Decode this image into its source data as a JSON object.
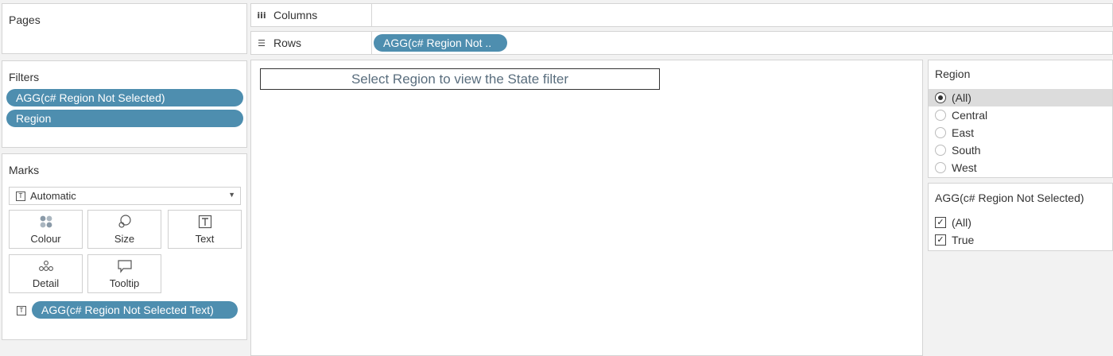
{
  "pages": {
    "title": "Pages"
  },
  "filters": {
    "title": "Filters",
    "pills": [
      "AGG(c# Region Not Selected)",
      "Region"
    ]
  },
  "marks": {
    "title": "Marks",
    "mark_type": "Automatic",
    "buttons": {
      "colour": "Colour",
      "size": "Size",
      "text": "Text",
      "detail": "Detail",
      "tooltip": "Tooltip"
    },
    "text_pill": "AGG(c# Region Not Selected Text)"
  },
  "shelves": {
    "columns_label": "Columns",
    "rows_label": "Rows",
    "rows_pill": "AGG(c# Region Not .."
  },
  "canvas": {
    "title": "Select Region to view the State filter"
  },
  "region_filter": {
    "title": "Region",
    "options": [
      "(All)",
      "Central",
      "East",
      "South",
      "West"
    ],
    "selected": "(All)"
  },
  "agg_filter": {
    "title": "AGG(c# Region Not Selected)",
    "options": [
      "(All)",
      "True"
    ],
    "checked": [
      true,
      true
    ]
  },
  "colors": {
    "pill": "#4e8eaf",
    "background": "#f2f2f2",
    "title_text": "#5a6e7e"
  }
}
